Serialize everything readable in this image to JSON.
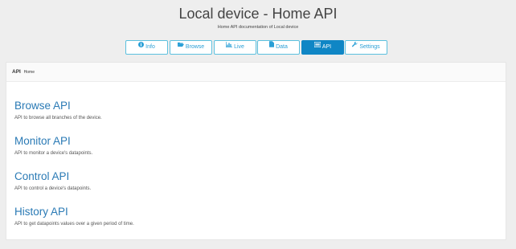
{
  "header": {
    "title": "Local device - Home API",
    "subtitle": "Home API documentation of Local device"
  },
  "tabs": [
    {
      "label": "Info",
      "icon": "info-icon",
      "active": false
    },
    {
      "label": "Browse",
      "icon": "folder-open-icon",
      "active": false
    },
    {
      "label": "Live",
      "icon": "chart-icon",
      "active": false
    },
    {
      "label": "Data",
      "icon": "file-icon",
      "active": false
    },
    {
      "label": "API",
      "icon": "list-icon",
      "active": true
    },
    {
      "label": "Settings",
      "icon": "wrench-icon",
      "active": false
    }
  ],
  "panel": {
    "title": "API",
    "subtitle": "Home"
  },
  "sections": [
    {
      "heading": "Browse API",
      "description": "API to browse all branches of the device."
    },
    {
      "heading": "Monitor API",
      "description": "API to monitor a device's datapoints."
    },
    {
      "heading": "Control API",
      "description": "API to control a device's datapoints."
    },
    {
      "heading": "History API",
      "description": "API to get datapoints values over a given period of time."
    }
  ],
  "colors": {
    "accent": "#2a9fd6",
    "active_tab": "#0f86c5",
    "link": "#2a7ab5",
    "background": "#eeeeee"
  }
}
